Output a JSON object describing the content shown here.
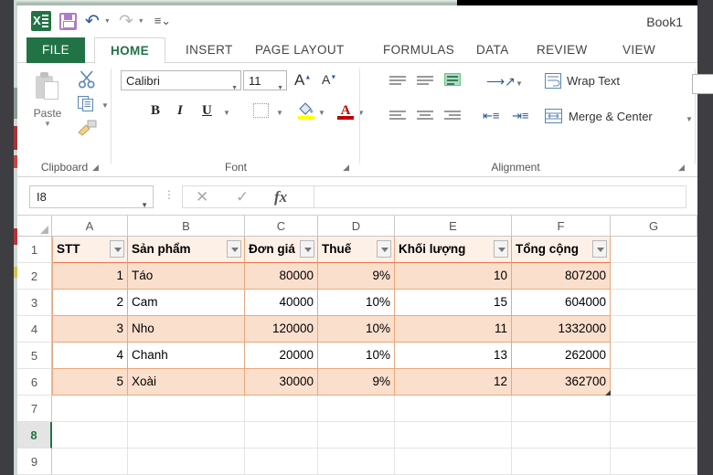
{
  "window": {
    "title": "Book1"
  },
  "quick_access": {
    "logo": "excel-logo",
    "items": [
      {
        "name": "save-icon",
        "label": "Save"
      },
      {
        "name": "undo-icon",
        "label": "Undo"
      },
      {
        "name": "redo-icon",
        "label": "Redo"
      },
      {
        "name": "customize-qat-icon",
        "label": "Customize Quick Access Toolbar"
      }
    ]
  },
  "ribbon": {
    "tabs": [
      {
        "label": "FILE",
        "active": false
      },
      {
        "label": "HOME",
        "active": true
      },
      {
        "label": "INSERT",
        "active": false
      },
      {
        "label": "PAGE LAYOUT",
        "active": false
      },
      {
        "label": "FORMULAS",
        "active": false
      },
      {
        "label": "DATA",
        "active": false
      },
      {
        "label": "REVIEW",
        "active": false
      },
      {
        "label": "VIEW",
        "active": false
      }
    ],
    "groups": {
      "clipboard": {
        "label": "Clipboard",
        "paste_label": "Paste",
        "cut_label": "Cut",
        "copy_label": "Copy",
        "format_painter_label": "Format Painter"
      },
      "font": {
        "label": "Font",
        "font_name": "Calibri",
        "font_size": "11",
        "grow_label": "A",
        "shrink_label": "A",
        "bold_label": "B",
        "italic_label": "I",
        "underline_label": "U",
        "fill_color": "#ffff00",
        "font_color": "#c00000"
      },
      "alignment": {
        "label": "Alignment",
        "wrap_text_label": "Wrap Text",
        "merge_center_label": "Merge & Center",
        "selected_vertical_align": "bottom-align"
      }
    }
  },
  "formula_bar": {
    "name_box_value": "I8",
    "cancel_label": "✕",
    "enter_label": "✓",
    "fx_label": "fx",
    "formula_value": ""
  },
  "sheet": {
    "columns": [
      "A",
      "B",
      "C",
      "D",
      "E",
      "F",
      "G"
    ],
    "rows": [
      "1",
      "2",
      "3",
      "4",
      "5",
      "6",
      "7",
      "8",
      "9"
    ],
    "active_row": "8",
    "table": {
      "headers": [
        "STT",
        "Sản phẩm",
        "Đơn giá",
        "Thuế",
        "Khối lượng",
        "Tổng cộng"
      ],
      "rows": [
        {
          "stt": "1",
          "product": "Táo",
          "price": "80000",
          "tax": "9%",
          "qty": "10",
          "total": "807200"
        },
        {
          "stt": "2",
          "product": "Cam",
          "price": "40000",
          "tax": "10%",
          "qty": "15",
          "total": "604000"
        },
        {
          "stt": "3",
          "product": "Nho",
          "price": "120000",
          "tax": "10%",
          "qty": "11",
          "total": "1332000"
        },
        {
          "stt": "4",
          "product": "Chanh",
          "price": "20000",
          "tax": "10%",
          "qty": "13",
          "total": "262000"
        },
        {
          "stt": "5",
          "product": "Xoài",
          "price": "30000",
          "tax": "9%",
          "qty": "12",
          "total": "362700"
        }
      ],
      "band_color": "#fbdfcd",
      "border_color": "#e8a87c"
    }
  }
}
